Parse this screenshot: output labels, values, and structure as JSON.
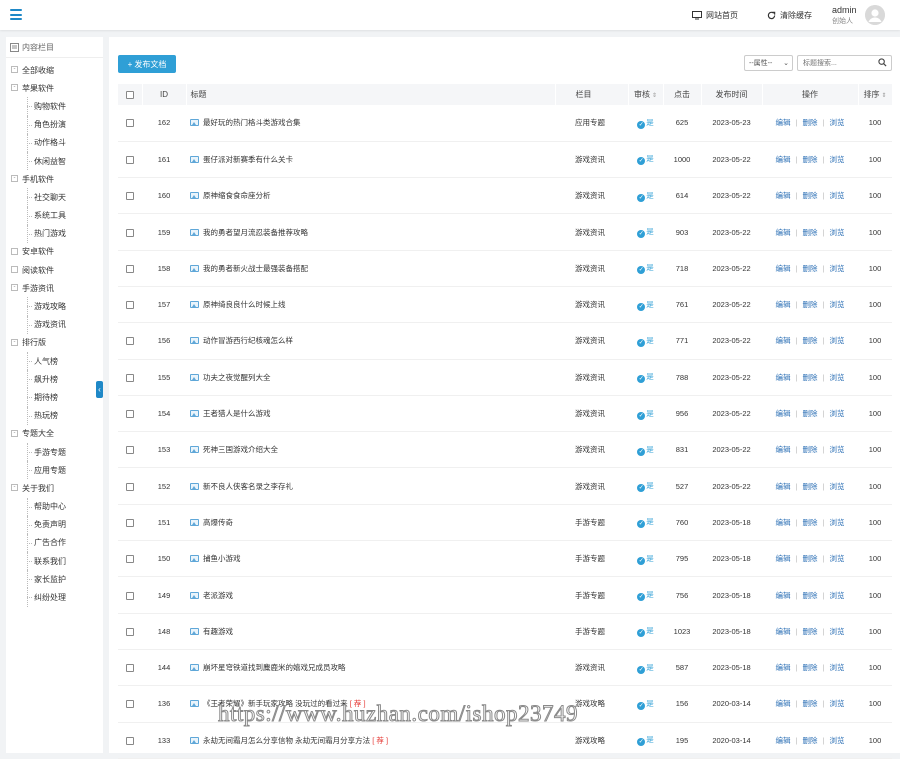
{
  "topbar": {
    "site_home": "网站首页",
    "clear_cache": "清除缓存",
    "user_name": "admin",
    "user_role": "创始人"
  },
  "sidebar": {
    "title": "内容栏目",
    "items": [
      {
        "label": "全部收缩",
        "level": 0,
        "toggle": "-"
      },
      {
        "label": "苹果软件",
        "level": 0,
        "toggle": "-"
      },
      {
        "label": "购物软件",
        "level": 1
      },
      {
        "label": "角色扮演",
        "level": 1
      },
      {
        "label": "动作格斗",
        "level": 1
      },
      {
        "label": "休闲益智",
        "level": 1
      },
      {
        "label": "手机软件",
        "level": 0,
        "toggle": "-"
      },
      {
        "label": "社交聊天",
        "level": 1
      },
      {
        "label": "系统工具",
        "level": 1
      },
      {
        "label": "热门游戏",
        "level": 1
      },
      {
        "label": "安卓软件",
        "level": 0
      },
      {
        "label": "阅读软件",
        "level": 0
      },
      {
        "label": "手游资讯",
        "level": 0,
        "toggle": "-"
      },
      {
        "label": "游戏攻略",
        "level": 1
      },
      {
        "label": "游戏资讯",
        "level": 1
      },
      {
        "label": "排行版",
        "level": 0,
        "toggle": "-"
      },
      {
        "label": "人气榜",
        "level": 1
      },
      {
        "label": "飙升榜",
        "level": 1
      },
      {
        "label": "期待榜",
        "level": 1
      },
      {
        "label": "热玩榜",
        "level": 1
      },
      {
        "label": "专题大全",
        "level": 0,
        "toggle": "-"
      },
      {
        "label": "手游专题",
        "level": 1
      },
      {
        "label": "应用专题",
        "level": 1
      },
      {
        "label": "关于我们",
        "level": 0,
        "toggle": "-"
      },
      {
        "label": "帮助中心",
        "level": 1
      },
      {
        "label": "免责声明",
        "level": 1
      },
      {
        "label": "广告合作",
        "level": 1
      },
      {
        "label": "联系我们",
        "level": 1
      },
      {
        "label": "家长监护",
        "level": 1
      },
      {
        "label": "纠纷处理",
        "level": 1
      }
    ]
  },
  "toolbar": {
    "publish": "发布文档",
    "attr_select": "--属性--",
    "search_placeholder": "标题搜索..."
  },
  "table": {
    "headers": {
      "id": "ID",
      "title": "标题",
      "category": "栏目",
      "review": "审核",
      "clicks": "点击",
      "time": "发布时间",
      "ops": "操作",
      "order": "排序"
    },
    "ops": {
      "edit": "编辑",
      "delete": "删除",
      "view": "浏览"
    },
    "review_yes": "是",
    "rows": [
      {
        "id": "162",
        "title": "最好玩的热门格斗类游戏合集",
        "category": "应用专题",
        "clicks": "625",
        "time": "2023-05-23",
        "order": "100"
      },
      {
        "id": "161",
        "title": "蛋仔派对新赛季有什么关卡",
        "category": "游戏资讯",
        "clicks": "1000",
        "time": "2023-05-22",
        "order": "100"
      },
      {
        "id": "160",
        "title": "原神缩食食命座分析",
        "category": "游戏资讯",
        "clicks": "614",
        "time": "2023-05-22",
        "order": "100"
      },
      {
        "id": "159",
        "title": "我的勇者望月流忍装备推荐攻略",
        "category": "游戏资讯",
        "clicks": "903",
        "time": "2023-05-22",
        "order": "100"
      },
      {
        "id": "158",
        "title": "我的勇者新火战士最强装备搭配",
        "category": "游戏资讯",
        "clicks": "718",
        "time": "2023-05-22",
        "order": "100"
      },
      {
        "id": "157",
        "title": "原神绮良良什么时候上线",
        "category": "游戏资讯",
        "clicks": "761",
        "time": "2023-05-22",
        "order": "100"
      },
      {
        "id": "156",
        "title": "动作冒游西行纪核魂怎么样",
        "category": "游戏资讯",
        "clicks": "771",
        "time": "2023-05-22",
        "order": "100"
      },
      {
        "id": "155",
        "title": "功夫之夜觉醒列大全",
        "category": "游戏资讯",
        "clicks": "788",
        "time": "2023-05-22",
        "order": "100"
      },
      {
        "id": "154",
        "title": "王者猎人是什么游戏",
        "category": "游戏资讯",
        "clicks": "956",
        "time": "2023-05-22",
        "order": "100"
      },
      {
        "id": "153",
        "title": "死神三国游戏介绍大全",
        "category": "游戏资讯",
        "clicks": "831",
        "time": "2023-05-22",
        "order": "100"
      },
      {
        "id": "152",
        "title": "新不良人侠客名录之李存礼",
        "category": "游戏资讯",
        "clicks": "527",
        "time": "2023-05-22",
        "order": "100"
      },
      {
        "id": "151",
        "title": "高爆传奇",
        "category": "手游专题",
        "clicks": "760",
        "time": "2023-05-18",
        "order": "100"
      },
      {
        "id": "150",
        "title": "捕鱼小游戏",
        "category": "手游专题",
        "clicks": "795",
        "time": "2023-05-18",
        "order": "100"
      },
      {
        "id": "149",
        "title": "老派游戏",
        "category": "手游专题",
        "clicks": "756",
        "time": "2023-05-18",
        "order": "100"
      },
      {
        "id": "148",
        "title": "有趣游戏",
        "category": "手游专题",
        "clicks": "1023",
        "time": "2023-05-18",
        "order": "100"
      },
      {
        "id": "144",
        "title": "崩坏星穹铁道找到麋鹿米的嬉戏兄成员攻略",
        "category": "游戏资讯",
        "clicks": "587",
        "time": "2023-05-18",
        "order": "100"
      },
      {
        "id": "136",
        "title": "《王者荣耀》新手玩家攻略 没玩过的看过来",
        "tag": "[ 荐 ]",
        "category": "游戏攻略",
        "clicks": "156",
        "time": "2020-03-14",
        "order": "100"
      },
      {
        "id": "133",
        "title": "永劫无间霜月怎么分享信物 永劫无间霜月分享方法",
        "tag": "[ 荐 ]",
        "category": "游戏攻略",
        "clicks": "195",
        "time": "2020-03-14",
        "order": "100"
      }
    ]
  },
  "watermark": "https://www.huzhan.com/ishop23749",
  "colors": {
    "accent": "#1e88c7",
    "button": "#2f9fd6",
    "link": "#2b6fb5",
    "tag": "#e53935"
  }
}
